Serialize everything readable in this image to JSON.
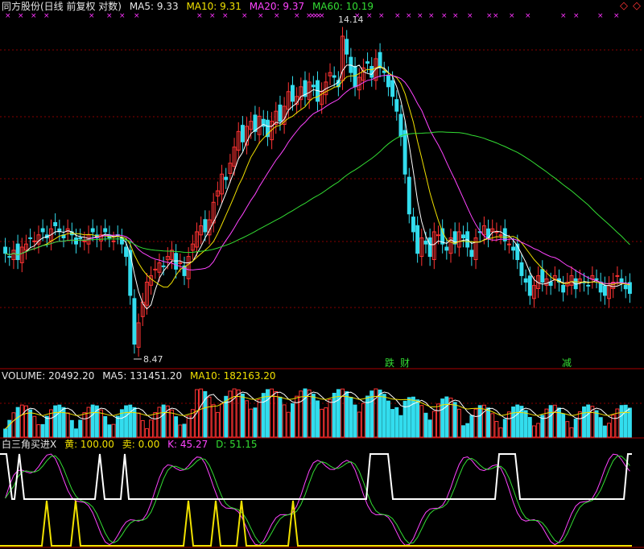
{
  "main_header": {
    "title": "同方股份(日线 前复权 对数)",
    "ma5_label": "MA5: 9.33",
    "ma10_label": "MA10: 9.31",
    "ma20_label": "MA20: 9.37",
    "ma60_label": "MA60: 10.19"
  },
  "volume_header": {
    "volume_label": "VOLUME: 20492.20",
    "ma5_label": "MA5: 131451.20",
    "ma10_label": "MA10: 182163.20"
  },
  "indicator_header": {
    "name": "白三角买进X",
    "yellow_label": "黄: 100.00",
    "sell_label": "卖: 0.00",
    "k_label": "K: 45.27",
    "d_label": "D: 51.15"
  },
  "annotations": {
    "high_price": "14.14",
    "low_price": "8.47",
    "signal_1": "跌",
    "signal_2": "财",
    "signal_3": "减"
  },
  "colors": {
    "up_candle": "#ff3333",
    "down_candle": "#33ddee",
    "ma5": "#ffffff",
    "ma10": "#f0e000",
    "ma20": "#ff44ff",
    "ma60": "#33dd33",
    "grid": "#880000",
    "signal_marker": "#ff33ff"
  },
  "chart_data": [
    {
      "type": "candlestick",
      "title": "同方股份(日线 前复权 对数)",
      "y_scale": "log",
      "ylim": [
        8.3,
        14.6
      ],
      "grid": true,
      "series_summary": [
        {
          "name": "MA5",
          "last": 9.33
        },
        {
          "name": "MA10",
          "last": 9.31
        },
        {
          "name": "MA20",
          "last": 9.37
        },
        {
          "name": "MA60",
          "last": 10.19
        }
      ],
      "close": [
        9.95,
        9.9,
        10.0,
        9.85,
        10.05,
        10.1,
        10.2,
        10.15,
        10.25,
        10.3,
        10.2,
        10.35,
        10.4,
        10.3,
        10.2,
        10.35,
        10.25,
        10.1,
        10.2,
        10.15,
        10.25,
        10.3,
        10.2,
        10.25,
        10.3,
        10.2,
        10.15,
        10.25,
        10.1,
        9.9,
        9.3,
        8.6,
        8.9,
        9.2,
        9.5,
        9.6,
        9.7,
        9.8,
        9.75,
        9.9,
        10.0,
        9.7,
        9.8,
        9.6,
        9.9,
        10.1,
        10.3,
        10.4,
        10.3,
        10.5,
        10.8,
        11.0,
        11.3,
        11.2,
        11.5,
        11.8,
        12.1,
        11.9,
        12.2,
        12.3,
        12.1,
        12.4,
        12.2,
        12.0,
        12.3,
        12.5,
        12.3,
        12.6,
        12.9,
        12.7,
        12.8,
        13.0,
        12.8,
        13.1,
        13.0,
        12.7,
        12.9,
        13.1,
        13.3,
        13.2,
        13.0,
        14.1,
        13.7,
        13.3,
        13.0,
        13.2,
        13.4,
        13.5,
        13.2,
        13.6,
        13.4,
        13.3,
        13.0,
        12.8,
        12.5,
        12.0,
        11.3,
        10.6,
        10.3,
        9.95,
        10.2,
        10.1,
        9.9,
        10.3,
        10.25,
        10.1,
        10.0,
        10.2,
        10.1,
        10.3,
        10.2,
        10.05,
        9.9,
        10.2,
        10.3,
        10.4,
        10.2,
        10.35,
        10.3,
        10.25,
        10.15,
        10.1,
        10.0,
        9.85,
        9.6,
        9.5,
        9.3,
        9.45,
        9.6,
        9.5,
        9.55,
        9.45,
        9.6,
        9.5,
        9.35,
        9.5,
        9.6,
        9.4,
        9.55,
        9.5,
        9.45,
        9.6,
        9.55,
        9.35,
        9.3,
        9.45,
        9.5,
        9.6,
        9.5,
        9.4,
        9.33
      ],
      "volume_header": {
        "VOLUME": 20492.2,
        "MA5": 131451.2,
        "MA10": 182163.2
      },
      "indicator": {
        "name": "白三角买进X",
        "黄": 100.0,
        "卖": 0.0,
        "K": 45.27,
        "D": 51.15
      }
    }
  ]
}
